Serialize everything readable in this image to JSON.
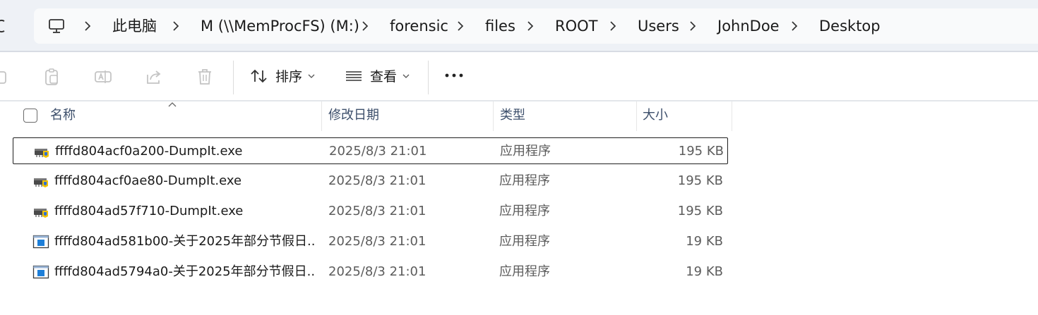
{
  "address_bar": {
    "breadcrumbs": [
      "此电脑",
      "M (\\\\MemProcFS) (M:)",
      "forensic",
      "files",
      "ROOT",
      "Users",
      "JohnDoe",
      "Desktop"
    ]
  },
  "commands": {
    "sort_label": "排序",
    "view_label": "查看"
  },
  "columns": {
    "name": "名称",
    "modified": "修改日期",
    "type": "类型",
    "size": "大小"
  },
  "files": [
    {
      "name": "ffffd804acf0a200-DumpIt.exe",
      "modified": "2025/8/3 21:01",
      "type": "应用程序",
      "size": "195 KB",
      "icon": "dumpit-app-icon",
      "selected": true
    },
    {
      "name": "ffffd804acf0ae80-DumpIt.exe",
      "modified": "2025/8/3 21:01",
      "type": "应用程序",
      "size": "195 KB",
      "icon": "dumpit-app-icon",
      "selected": false
    },
    {
      "name": "ffffd804ad57f710-DumpIt.exe",
      "modified": "2025/8/3 21:01",
      "type": "应用程序",
      "size": "195 KB",
      "icon": "dumpit-app-icon",
      "selected": false
    },
    {
      "name": "ffffd804ad581b00-关于2025年部分节假日...",
      "modified": "2025/8/3 21:01",
      "type": "应用程序",
      "size": "19 KB",
      "icon": "window-app-icon",
      "selected": false
    },
    {
      "name": "ffffd804ad5794a0-关于2025年部分节假日...",
      "modified": "2025/8/3 21:01",
      "type": "应用程序",
      "size": "19 KB",
      "icon": "window-app-icon",
      "selected": false
    }
  ]
}
